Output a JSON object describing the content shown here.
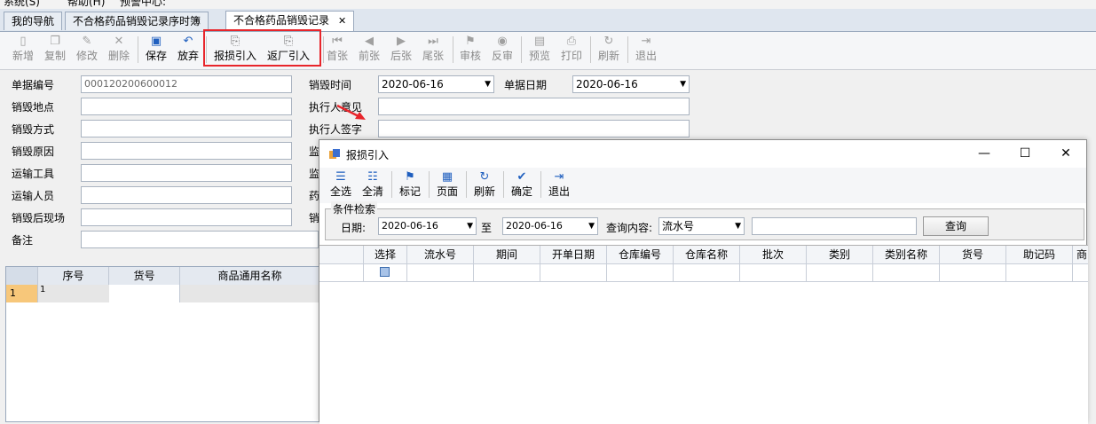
{
  "top_strip": {
    "items": [
      "系统(S)",
      "帮助(H)",
      "预警中心:"
    ]
  },
  "tabs": [
    {
      "label": "我的导航"
    },
    {
      "label": "不合格药品销毁记录序时簿"
    },
    {
      "label": "不合格药品销毁记录",
      "active": true
    }
  ],
  "toolbar": {
    "new": "新增",
    "copy": "复制",
    "modify": "修改",
    "delete": "删除",
    "save": "保存",
    "discard": "放弃",
    "loss_import": "报损引入",
    "return_import": "返厂引入",
    "first": "首张",
    "prev": "前张",
    "next": "后张",
    "last": "尾张",
    "audit": "审核",
    "unaudit": "反审",
    "preview": "预览",
    "print": "打印",
    "refresh": "刷新",
    "exit": "退出"
  },
  "form": {
    "doc_no_label": "单据编号",
    "doc_no_value": "000120200600012",
    "destroy_time_label": "销毁时间",
    "destroy_time_value": "2020-06-16",
    "doc_date_label": "单据日期",
    "doc_date_value": "2020-06-16",
    "place_label": "销毁地点",
    "executor_opinion_label": "执行人意见",
    "method_label": "销毁方式",
    "executor_sign_label": "执行人签字",
    "reason_label": "销毁原因",
    "supervise1_label": "监",
    "transport_tool_label": "运输工具",
    "supervise2_label": "监",
    "transport_person_label": "运输人员",
    "drug_label": "药",
    "after_scene_label": "销毁后现场",
    "misc_label": "销",
    "remark_label": "备注"
  },
  "main_grid": {
    "columns": [
      "序号",
      "货号",
      "商品通用名称"
    ],
    "rows": [
      {
        "row_no": "1",
        "seq": "1"
      }
    ]
  },
  "dialog": {
    "title": "报损引入",
    "window_buttons": {
      "minimize": "—",
      "maximize": "☐",
      "close": "✕"
    },
    "toolbar": {
      "select_all": "全选",
      "clear_all": "全清",
      "mark": "标记",
      "page": "页面",
      "refresh": "刷新",
      "confirm": "确定",
      "exit": "退出"
    },
    "search": {
      "group_title": "条件检索",
      "date_label": "日期:",
      "date_from": "2020-06-16",
      "to_label": "至",
      "date_to": "2020-06-16",
      "query_content_label": "查询内容:",
      "query_field": "流水号",
      "query_value": "",
      "query_button": "查询"
    },
    "grid": {
      "columns": [
        "选择",
        "流水号",
        "期间",
        "开单日期",
        "仓库编号",
        "仓库名称",
        "批次",
        "类别",
        "类别名称",
        "货号",
        "助记码",
        "商"
      ]
    }
  },
  "colors": {
    "highlight_box": "#e8252b",
    "arrow": "#e8252b",
    "icon_blue": "#1f5fbf",
    "row_selected": "#f7c77a"
  }
}
